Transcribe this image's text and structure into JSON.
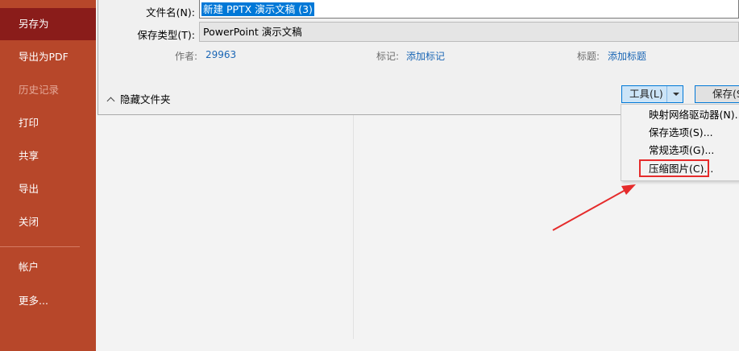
{
  "sidebar": {
    "items": [
      {
        "label": "另存为"
      },
      {
        "label": "导出为PDF"
      },
      {
        "label": "历史记录"
      },
      {
        "label": "打印"
      },
      {
        "label": "共享"
      },
      {
        "label": "导出"
      },
      {
        "label": "关闭"
      },
      {
        "label": "帐户"
      },
      {
        "label": "更多..."
      }
    ]
  },
  "dialog": {
    "filename_label": "文件名(N):",
    "filename_value": "新建 PPTX 演示文稿 (3)",
    "filetype_label": "保存类型(T):",
    "filetype_value": "PowerPoint 演示文稿",
    "author_label": "作者:",
    "author_value": "29963",
    "tags_label": "标记:",
    "tags_value": "添加标记",
    "title_label": "标题:",
    "title_value": "添加标题",
    "hide_folders": "隐藏文件夹",
    "tools_label": "工具(L)",
    "save_label": "保存(S"
  },
  "tools_menu": {
    "items": [
      {
        "label": "映射网络驱动器(N)..."
      },
      {
        "label": "保存选项(S)..."
      },
      {
        "label": "常规选项(G)..."
      },
      {
        "label": "压缩图片(C)..."
      }
    ]
  },
  "colors": {
    "sidebar_bg": "#b7472a",
    "sidebar_active": "#8a1c1a",
    "selection": "#0078d7",
    "annotation": "#e52b2b",
    "link": "#1a66b5"
  }
}
